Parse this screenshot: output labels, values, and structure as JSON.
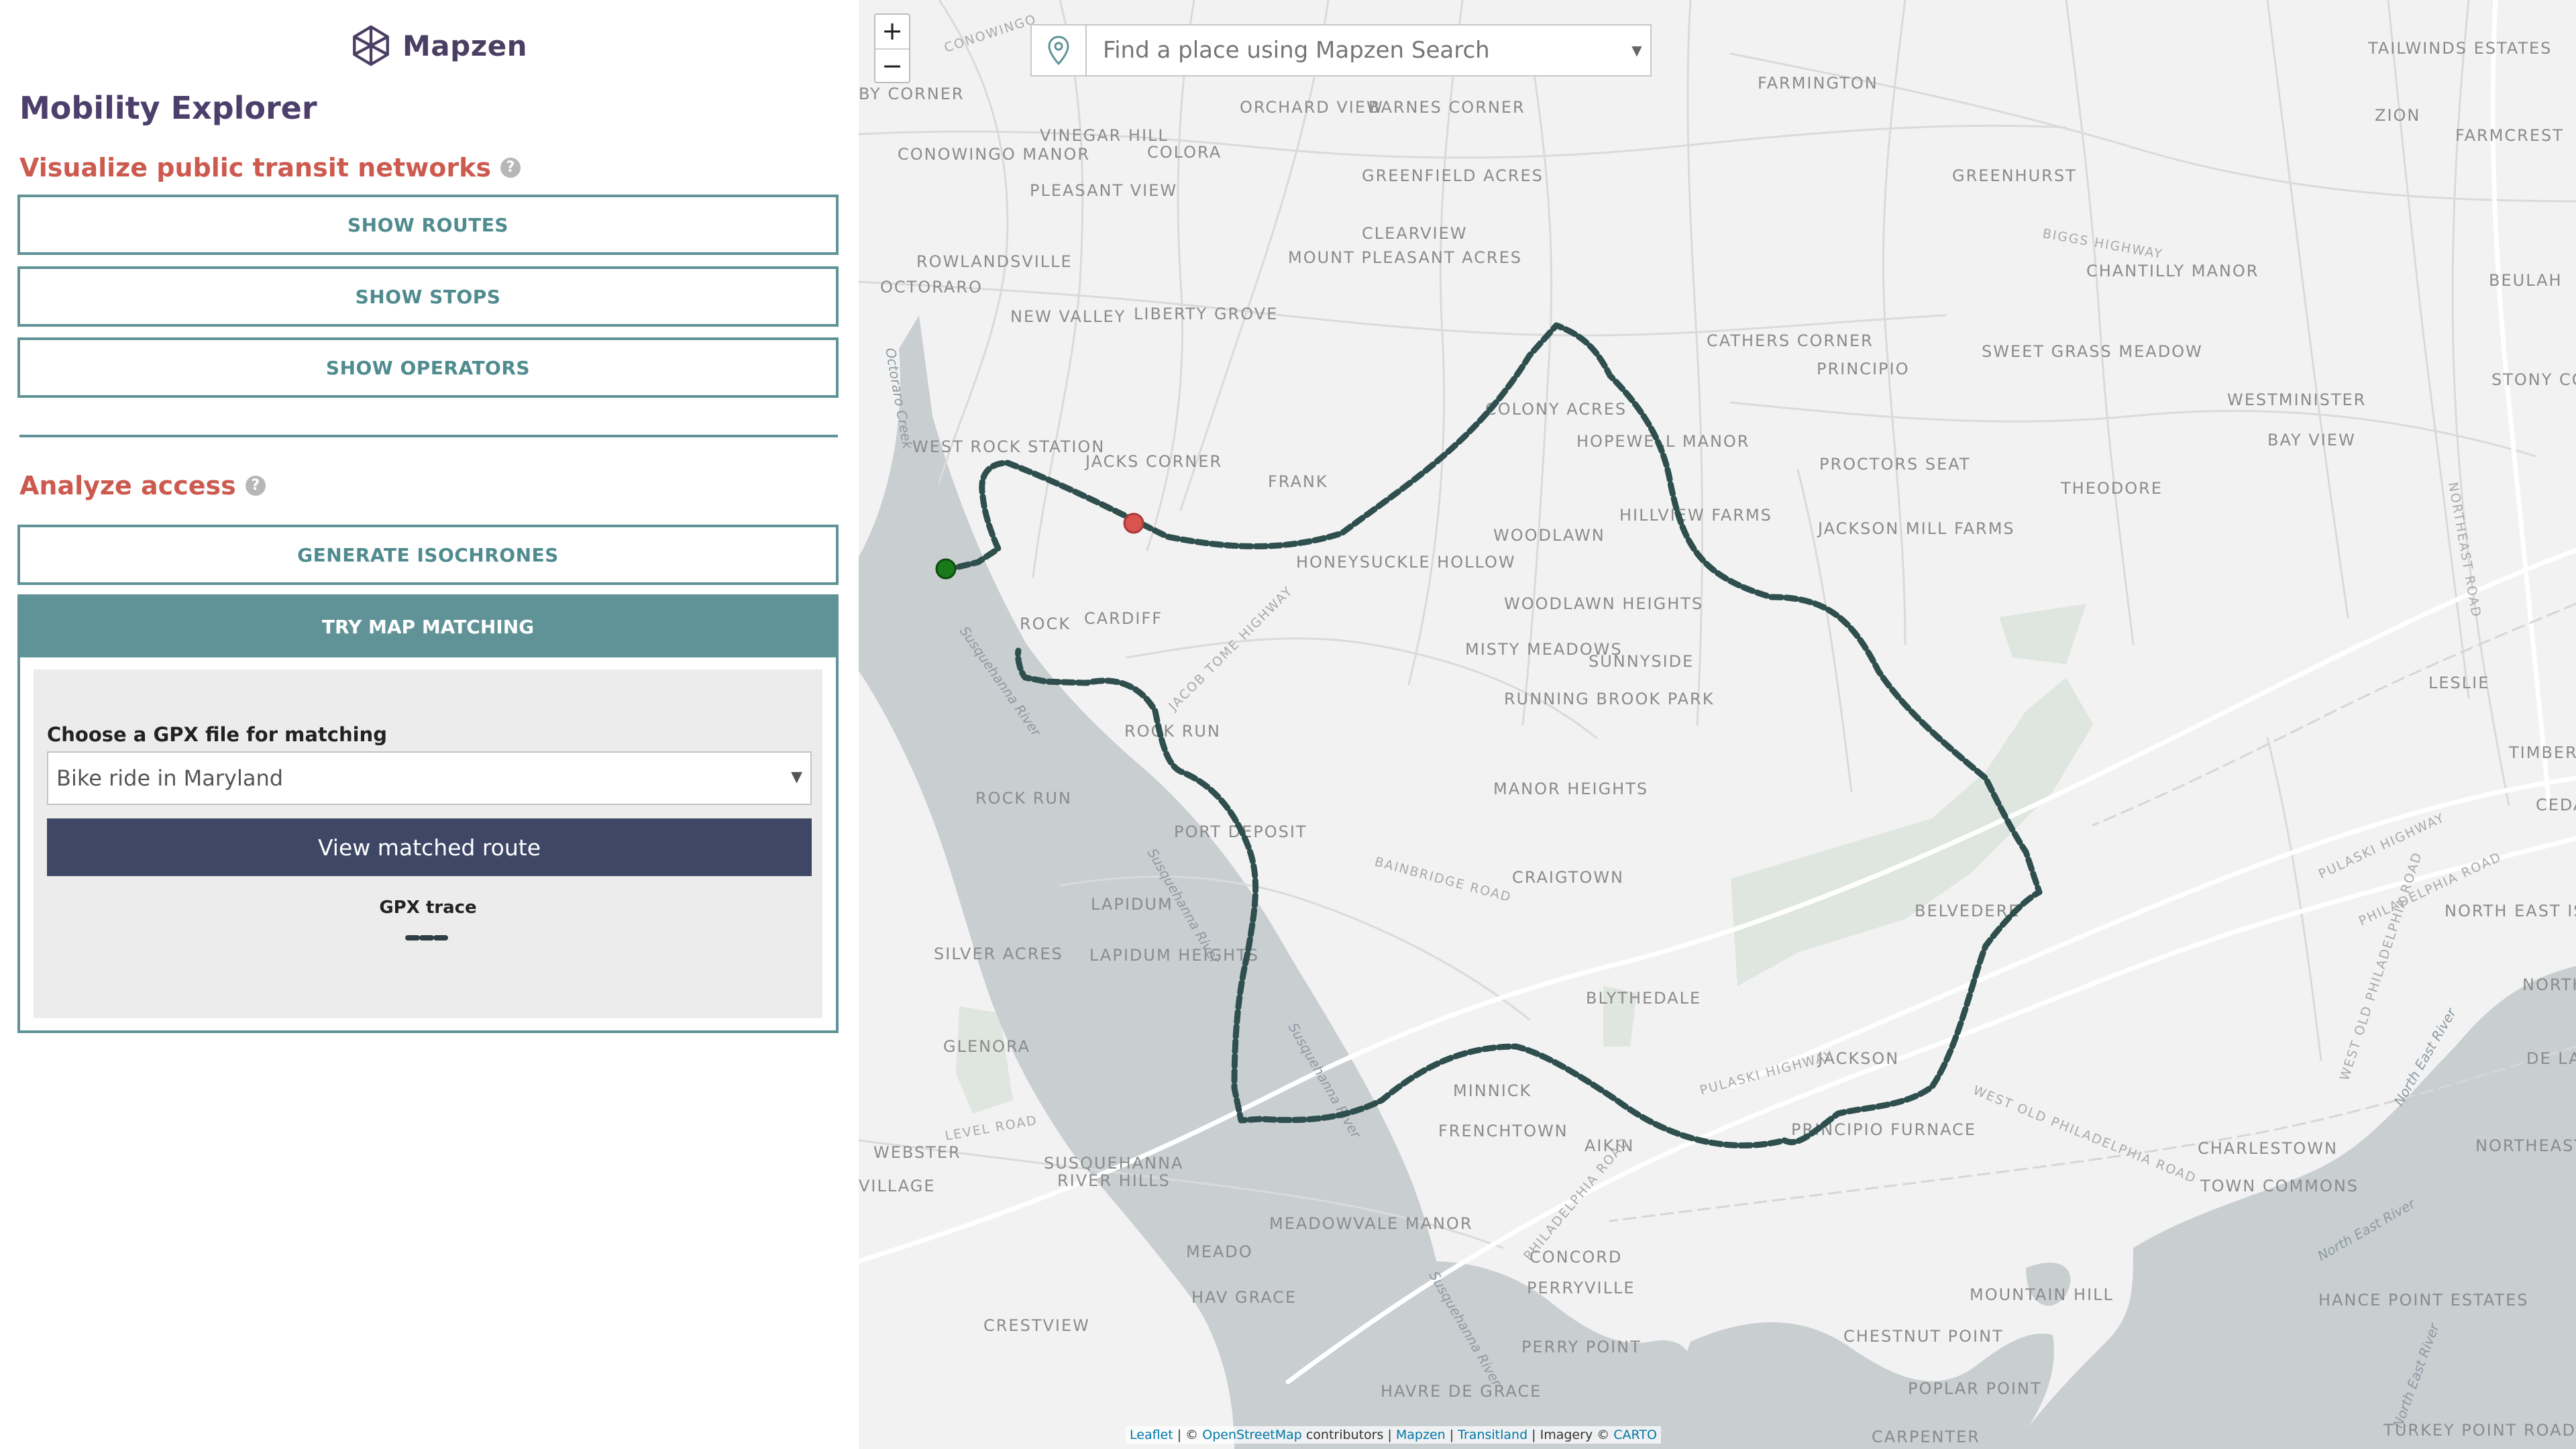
{
  "logo": {
    "text": "Mapzen"
  },
  "sidebar": {
    "app_title": "Mobility Explorer",
    "visualize": {
      "heading": "Visualize public transit networks",
      "buttons": [
        "SHOW ROUTES",
        "SHOW STOPS",
        "SHOW OPERATORS"
      ]
    },
    "analyze": {
      "heading": "Analyze access",
      "isochrones_button": "GENERATE ISOCHRONES",
      "map_matching_button": "TRY MAP MATCHING"
    },
    "map_matching": {
      "label": "Choose a GPX file for matching",
      "selected_file": "Bike ride in Maryland",
      "view_button": "View matched route",
      "legend_label": "GPX trace"
    }
  },
  "map": {
    "search_placeholder": "Find a place using Mapzen Search",
    "zoom_in": "+",
    "zoom_out": "−",
    "attribution": {
      "leaflet": "Leaflet",
      "sep1": " | © ",
      "osm": "OpenStreetMap",
      "contrib": " contributors | ",
      "mapzen": "Mapzen",
      "sep2": " | ",
      "transitland": "Transitland",
      "imagery": " | Imagery © ",
      "carto": "CARTO"
    },
    "colors": {
      "trace": "#3f6b6b",
      "water": "#c9ced1",
      "park": "#dfe5df",
      "start_marker": "#1a7a1a",
      "end_marker": "#d9534f"
    },
    "places": [
      "BY CORNER",
      "CONOWINGO MANOR",
      "VINEGAR HILL",
      "COLORA",
      "ORCHARD VIEW",
      "BARNES CORNER",
      "FARMINGTON",
      "TAILWINDS ESTATES",
      "ZION",
      "FARMCREST",
      "PLEASANT VIEW",
      "GREENFIELD ACRES",
      "GREENHURST",
      "ROWLANDSVILLE",
      "CLEARVIEW",
      "MOUNT PLEASANT ACRES",
      "CHANTILLY MANOR",
      "BEULAH",
      "OCTORARO",
      "NEW VALLEY",
      "LIBERTY GROVE",
      "CATHERS CORNER",
      "PRINCIPIO",
      "SWEET GRASS MEADOW",
      "WESTMINISTER",
      "STONY COU",
      "COLONY ACRES",
      "WEST ROCK STATION",
      "JACKS CORNER",
      "HOPEWELL MANOR",
      "PROCTORS SEAT",
      "BAY VIEW",
      "FRANK",
      "THEODORE",
      "HILLVIEW FARMS",
      "JACKSON MILL FARMS",
      "HONEYSUCKLE HOLLOW",
      "WOODLAWN",
      "ROCK",
      "CARDIFF",
      "WOODLAWN HEIGHTS",
      "MISTY MEADOWS",
      "SUNNYSIDE",
      "LESLIE",
      "RUNNING BROOK PARK",
      "ROCK RUN",
      "TIMBERE",
      "CEDA",
      "ROCK RUN",
      "PORT DEPOSIT",
      "MANOR HEIGHTS",
      "CRAIGTOWN",
      "NORTH EAST ISLES",
      "LAPIDUM",
      "BELVEDERE",
      "SILVER ACRES",
      "LAPIDUM HEIGHTS",
      "BLYTHEDALE",
      "NORTH HARI",
      "GLENORA",
      "JACKSON",
      "DE LA PLAI",
      "MINNICK",
      "FRENCHTOWN",
      "AIKIN",
      "PRINCIPIO FURNACE",
      "CHARLESTOWN",
      "TOWN COMMONS",
      "NORTHEAST HEIGHTS",
      "WEBSTER",
      "VILLAGE",
      "SUSQUEHANNA",
      "RIVER HILLS",
      "MEADOWVALE MANOR",
      "MEADO",
      "HAV GRACE",
      "CONCORD",
      "PERRYVILLE",
      "MOUNTAIN HILL",
      "HANCE POINT ESTATES",
      "CRESTVIEW",
      "PERRY POINT",
      "CHESTNUT POINT",
      "HAVRE DE GRACE",
      "POPLAR POINT",
      "CARPENTER",
      "TURKEY POINT ROAD"
    ],
    "water_labels": [
      "Octoraro Creek",
      "Susquehanna River",
      "Susquehanna River",
      "Susquehanna River",
      "Susquehanna River",
      "North East River",
      "North East River",
      "North East River"
    ],
    "road_labels": [
      "JACOB TOME HIGHWAY",
      "BAINBRIDGE ROAD",
      "PULASKI HIGHWAY",
      "WEST OLD PHILADELPHIA ROAD",
      "PHILADELPHIA ROAD",
      "BIGGS HIGHWAY",
      "NORTHEAST ROAD",
      "LEVEL ROAD",
      "PULASKI HIGHWAY",
      "WEST OLD PHILADELPHIA ROAD",
      "PHILADELPHIA ROAD",
      "CONOWINGO"
    ]
  }
}
